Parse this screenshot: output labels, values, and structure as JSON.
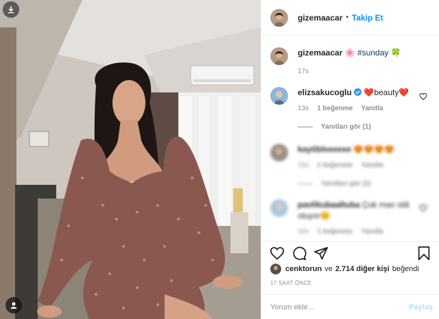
{
  "post_header": {
    "username": "gizemaacar",
    "separator": "•",
    "follow_label": "Takip Et"
  },
  "caption": {
    "username": "gizemaacar",
    "text": "🌸 #sunday 🍀",
    "time": "17s"
  },
  "comments": [
    {
      "username": "elizsakucoglu",
      "verified": true,
      "text": "❤️beauty❤️",
      "time": "13s",
      "likes": "1 beğenme",
      "reply_label": "Yanıtla",
      "view_replies": "Yanıtları gör (1)"
    },
    {
      "username": "kaytibleeeeee",
      "text": "😍😍😍😍",
      "time": "15s",
      "likes": "1 beğenme",
      "reply_label": "Yanıtla",
      "view_replies": "Yanıtları gör (1)",
      "blurred": true
    },
    {
      "username": "pavlikubaaltuba",
      "text": "Çok man stili oluyor😊",
      "time": "16s",
      "likes": "1 beğenme",
      "reply_label": "Yanıtla",
      "blurred": true
    }
  ],
  "likes_line": {
    "user": "cenktorun",
    "connector": "ve",
    "others": "2.714 diğer kişi",
    "suffix": "beğendi"
  },
  "timestamp": "17 SAAT ÖNCE",
  "comment_box": {
    "placeholder": "Yorum ekle...",
    "post_label": "Paylaş"
  },
  "colors": {
    "accent": "#0095f6",
    "muted": "#8e8e8e",
    "text": "#262626",
    "heart": "#ed4956"
  },
  "icons": [
    "download-icon",
    "user-tag-icon",
    "heart-icon",
    "comment-icon",
    "share-icon",
    "bookmark-icon",
    "verified-badge-icon"
  ]
}
